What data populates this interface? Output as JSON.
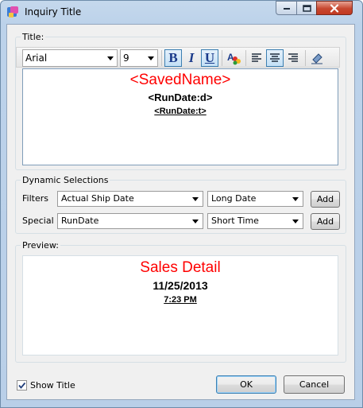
{
  "window": {
    "title": "Inquiry Title"
  },
  "title_group": {
    "label": "Title:"
  },
  "toolbar": {
    "font_name": "Arial",
    "font_size": "9",
    "bold_label": "B",
    "italic_label": "I",
    "underline_label": "U"
  },
  "editor": {
    "line1": "<SavedName>",
    "line2": "<RunDate:d>",
    "line3": "<RunDate:t>"
  },
  "dynamic": {
    "label": "Dynamic Selections",
    "filters_label": "Filters",
    "filters_field": "Actual Ship Date",
    "filters_format": "Long Date",
    "special_label": "Special",
    "special_field": "RunDate",
    "special_format": "Short Time",
    "add_label": "Add"
  },
  "preview": {
    "label": "Preview:",
    "line1": "Sales Detail",
    "line2": "11/25/2013",
    "line3": "7:23 PM"
  },
  "footer": {
    "show_title_label": "Show Title",
    "show_title_checked": true,
    "ok_label": "OK",
    "cancel_label": "Cancel"
  },
  "colors": {
    "accent_red": "#ff0000"
  }
}
